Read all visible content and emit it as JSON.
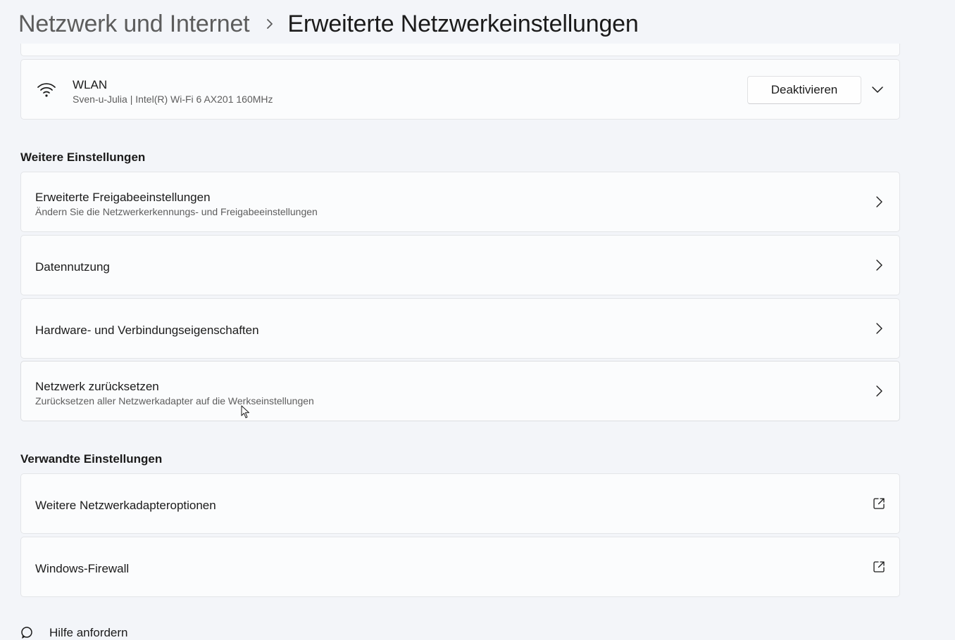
{
  "header": {
    "parent": "Netzwerk und Internet",
    "current": "Erweiterte Netzwerkeinstellungen"
  },
  "adapter": {
    "name": "WLAN",
    "description": "Sven-u-Julia | Intel(R) Wi-Fi 6 AX201 160MHz",
    "button_label": "Deaktivieren",
    "icon": "wifi-icon"
  },
  "more_settings": {
    "heading": "Weitere Einstellungen",
    "items": [
      {
        "title": "Erweiterte Freigabeeinstellungen",
        "subtitle": "Ändern Sie die Netzwerkerkennungs- und Freigabeeinstellungen",
        "icon": "chevron-right-icon"
      },
      {
        "title": "Datennutzung",
        "icon": "chevron-right-icon"
      },
      {
        "title": "Hardware- und Verbindungseigenschaften",
        "icon": "chevron-right-icon"
      },
      {
        "title": "Netzwerk zurücksetzen",
        "subtitle": "Zurücksetzen aller Netzwerkadapter auf die Werkseinstellungen",
        "icon": "chevron-right-icon"
      }
    ]
  },
  "related_settings": {
    "heading": "Verwandte Einstellungen",
    "items": [
      {
        "title": "Weitere Netzwerkadapteroptionen",
        "icon": "external-link-icon"
      },
      {
        "title": "Windows-Firewall",
        "icon": "external-link-icon"
      }
    ]
  },
  "footer": {
    "help_label": "Hilfe anfordern",
    "icon": "help-icon"
  }
}
